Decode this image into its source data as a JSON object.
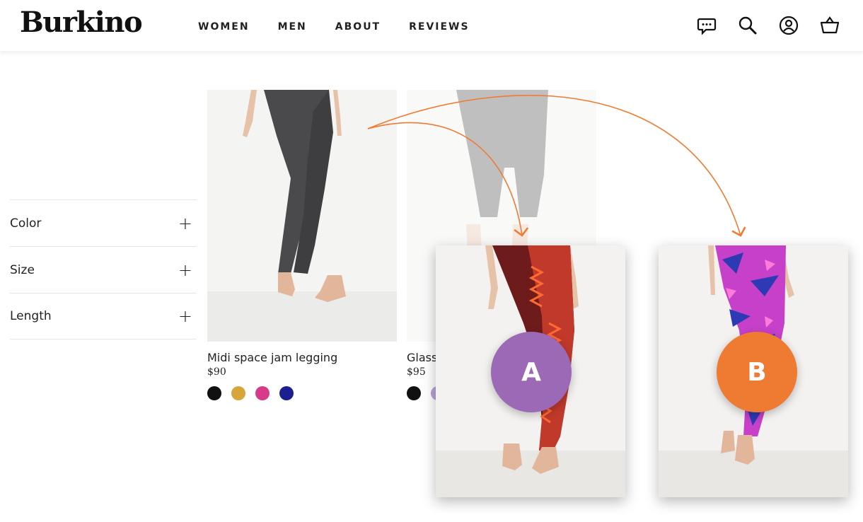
{
  "brand": {
    "logo": "Burkino"
  },
  "nav": [
    {
      "label": "WOMEN"
    },
    {
      "label": "MEN"
    },
    {
      "label": "ABOUT"
    },
    {
      "label": "REVIEWS"
    }
  ],
  "header_icons": [
    "chat-icon",
    "search-icon",
    "account-icon",
    "basket-icon"
  ],
  "filters": [
    {
      "label": "Color"
    },
    {
      "label": "Size"
    },
    {
      "label": "Length"
    }
  ],
  "products": [
    {
      "name": "Midi space jam legging",
      "price": "$90",
      "swatches": [
        "#111111",
        "#d6a63a",
        "#d83a8a",
        "#1b1f8f"
      ]
    },
    {
      "name": "Glass",
      "price": "$95",
      "swatches": [
        "#111111",
        "#b9a2d8"
      ]
    }
  ],
  "variants": [
    {
      "badge": "A",
      "badge_color": "#9b69b5"
    },
    {
      "badge": "B",
      "badge_color": "#ef7b32"
    }
  ],
  "colors": {
    "arrow": "#ef7b32"
  }
}
